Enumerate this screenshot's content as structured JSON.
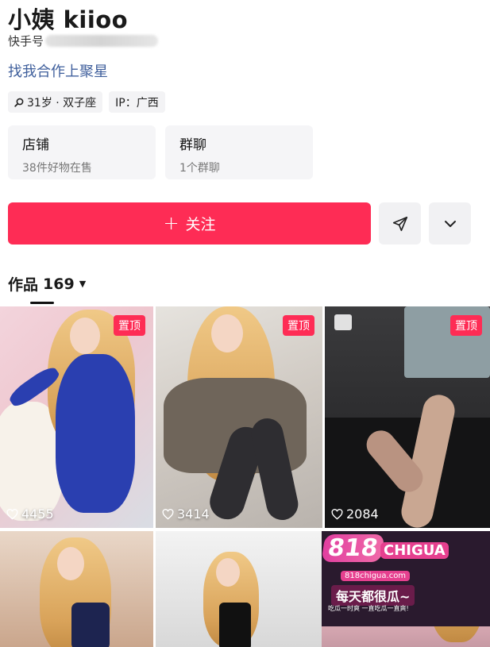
{
  "profile": {
    "name": "小姨 kiioo",
    "id_label": "快手号",
    "cooperation_link": "找我合作上聚星",
    "tags": [
      {
        "icon": "search-icon",
        "label": "31岁 · 双子座"
      },
      {
        "icon": null,
        "label": "IP：广西"
      }
    ],
    "cards": [
      {
        "title": "店铺",
        "subtitle": "38件好物在售"
      },
      {
        "title": "群聊",
        "subtitle": "1个群聊"
      }
    ]
  },
  "actions": {
    "follow_plus": "+",
    "follow_label": "关注",
    "share_icon": "send-icon",
    "more_icon": "chevron-down-icon"
  },
  "works": {
    "tab_label": "作品",
    "count": "169",
    "pin_label": "置顶",
    "items": [
      {
        "likes": "4455",
        "pinned": true
      },
      {
        "likes": "3414",
        "pinned": true
      },
      {
        "likes": "2084",
        "pinned": true
      }
    ]
  },
  "ad": {
    "logo_number": "818",
    "logo_word": "CHIGUA",
    "url": "818chigua.com",
    "slogan": "每天都很瓜~",
    "small_text": "吃瓜一时爽 一直吃瓜一直爽!"
  },
  "colors": {
    "accent": "#fe2c55",
    "link": "#3f5f9c"
  }
}
